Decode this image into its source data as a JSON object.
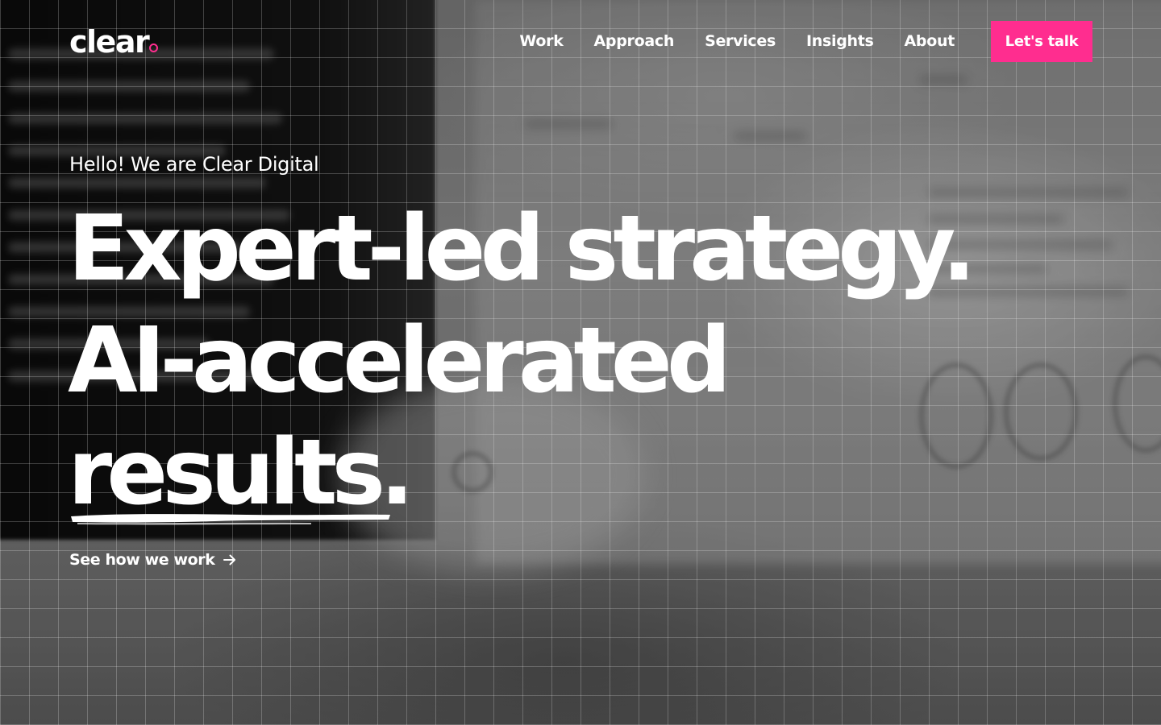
{
  "brand": {
    "logo_text": "clear",
    "accent_color": "#ff2d8f"
  },
  "nav": {
    "items": [
      {
        "label": "Work"
      },
      {
        "label": "Approach"
      },
      {
        "label": "Services"
      },
      {
        "label": "Insights"
      },
      {
        "label": "About"
      }
    ],
    "cta_label": "Let's talk"
  },
  "hero": {
    "intro": "Hello! We are Clear Digital",
    "headline_line1": "Expert-led strategy.",
    "headline_line2": "AI-accelerated",
    "headline_line3_word": "results",
    "headline_line3_punct": ".",
    "link_label": "See how we work",
    "link_icon": "arrow-right-icon"
  }
}
